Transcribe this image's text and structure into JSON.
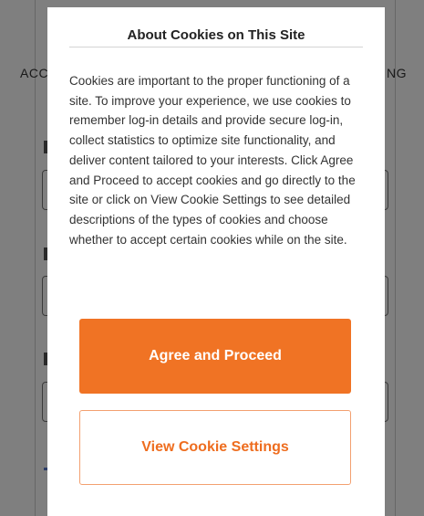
{
  "background": {
    "heading_left": "ACC",
    "heading_right": "NG"
  },
  "modal": {
    "title": "About Cookies on This Site",
    "body": "Cookies are important to the proper functioning of a site. To improve your experience, we use cookies to remember log-in details and provide secure log-in, collect statistics to optimize site functionality, and deliver content tailored to your interests. Click Agree and Proceed to accept cookies and go directly to the site or click on View Cookie Settings to see detailed descriptions of the types of cookies and choose whether to accept certain cookies while on the site.",
    "agree_button": "Agree and Proceed",
    "settings_button": "View Cookie Settings"
  },
  "colors": {
    "accent": "#f07324",
    "overlay": "rgba(0,0,0,0.5)"
  }
}
